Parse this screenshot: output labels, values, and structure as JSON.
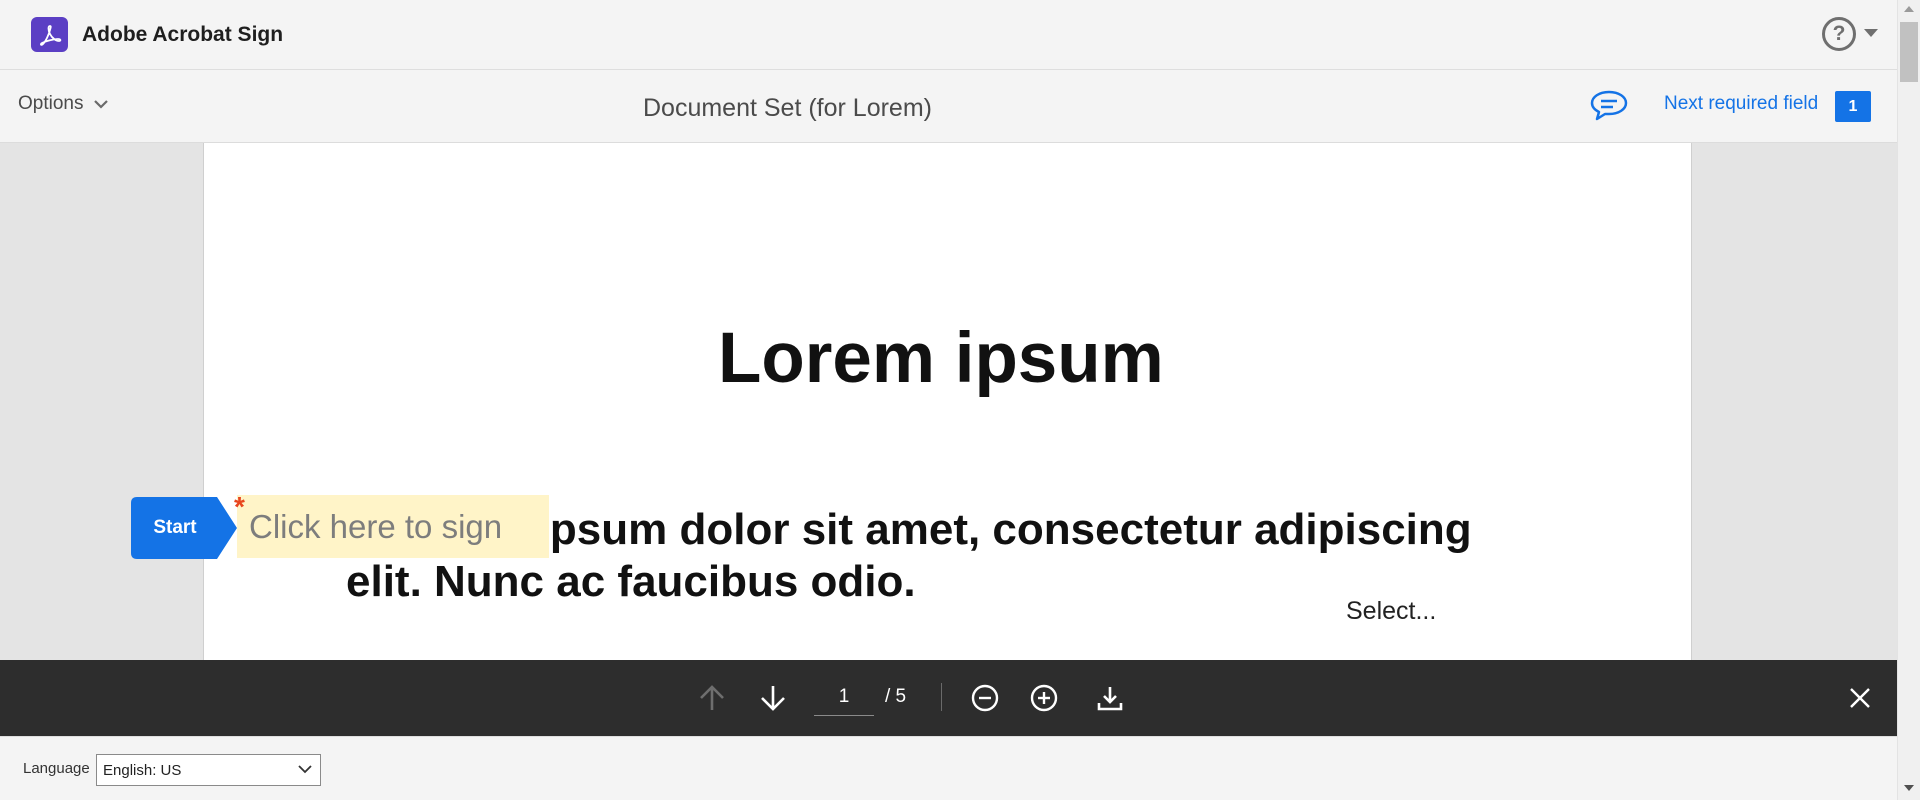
{
  "app": {
    "title": "Adobe Acrobat Sign",
    "logo_icon": "acrobat-logo-icon",
    "brand_color": "#5b3fc4"
  },
  "header": {
    "help_icon": "help-icon",
    "help_glyph": "?",
    "menu_icon": "caret-down-icon"
  },
  "toolbar": {
    "options_label": "Options",
    "document_title": "Document Set (for Lorem)",
    "comment_icon": "comment-icon",
    "next_field_label": "Next required field",
    "next_field_count": "1",
    "accent_color": "#1473e6"
  },
  "document": {
    "heading": "Lorem ipsum",
    "paragraph": "Lorem ipsum dolor sit amet, consectetur adipiscing elit. Nunc ac faucibus odio.",
    "select_field": "Select..."
  },
  "signing": {
    "start_label": "Start",
    "sign_placeholder": "Click here to sign",
    "required_marker": "*",
    "field_color": "#fff4c8",
    "required_color": "#e8461e"
  },
  "controls": {
    "current_page": "1",
    "total_pages": "/ 5"
  },
  "footer": {
    "language_label": "Language",
    "language_value": "English: US"
  }
}
